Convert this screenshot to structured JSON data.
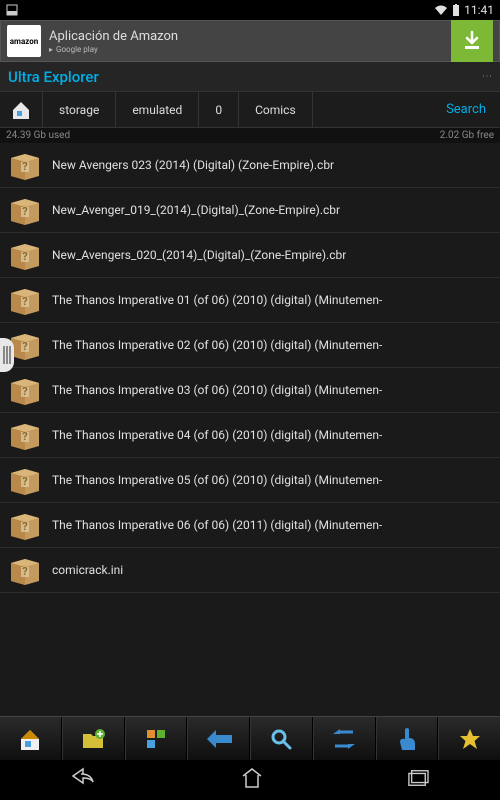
{
  "status": {
    "time": "11:41"
  },
  "ad": {
    "text": "Aplicación de Amazon",
    "store": "Google play",
    "logo": "amazon"
  },
  "title": "Ultra Explorer",
  "breadcrumb": [
    "storage",
    "emulated",
    "0",
    "Comics"
  ],
  "search_label": "Search",
  "storage": {
    "used": "24.39 Gb used",
    "free": "2.02 Gb free"
  },
  "files": [
    {
      "name": "New Avengers 023 (2014) (Digital) (Zone-Empire).cbr"
    },
    {
      "name": "New_Avenger_019_(2014)_(Digital)_(Zone-Empire).cbr"
    },
    {
      "name": "New_Avengers_020_(2014)_(Digital)_(Zone-Empire).cbr"
    },
    {
      "name": "The Thanos Imperative 01 (of 06) (2010) (digital) (Minutemen-"
    },
    {
      "name": "The Thanos Imperative 02 (of 06) (2010) (digital) (Minutemen-"
    },
    {
      "name": "The Thanos Imperative 03 (of 06) (2010) (digital) (Minutemen-"
    },
    {
      "name": "The Thanos Imperative 04 (of 06) (2010) (digital) (Minutemen-"
    },
    {
      "name": "The Thanos Imperative 05 (of 06) (2010) (digital) (Minutemen-"
    },
    {
      "name": "The Thanos Imperative 06 (of 06) (2011) (digital) (Minutemen-"
    },
    {
      "name": "comicrack.ini"
    }
  ],
  "toolbar_icons": [
    "home-icon",
    "add-folder-icon",
    "sort-icon",
    "back-icon",
    "search-icon",
    "refresh-icon",
    "touch-icon",
    "star-icon"
  ]
}
